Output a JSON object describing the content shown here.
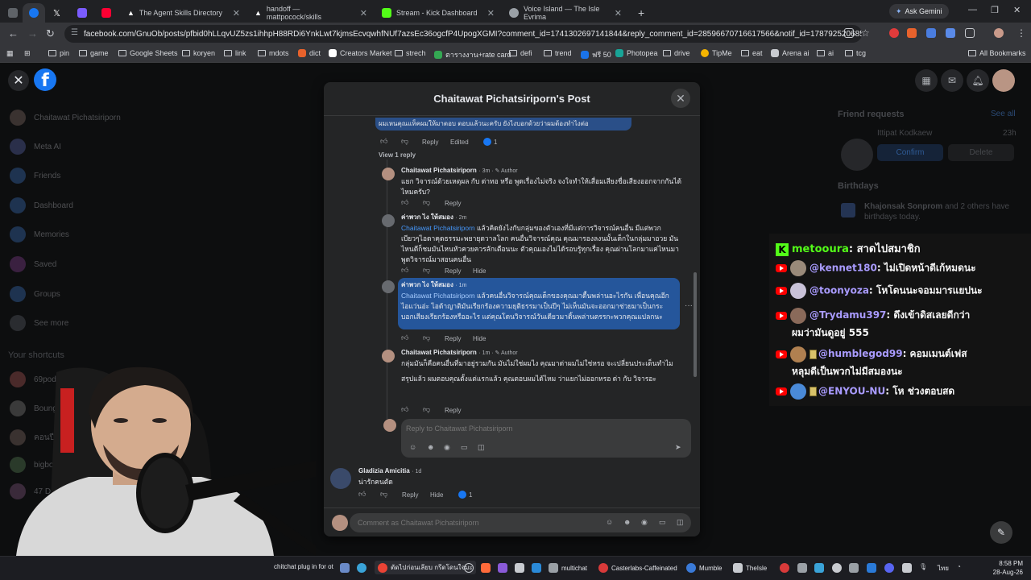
{
  "browser": {
    "tabs": [
      {
        "label": "",
        "favicon_color": "#5f6368"
      },
      {
        "label": "",
        "favicon_color": "#1877f2"
      },
      {
        "label": "",
        "favicon_color": "#ffffff"
      },
      {
        "label": "",
        "favicon_color": "#7b5cff"
      },
      {
        "label": "",
        "favicon_color": "#ff0033"
      },
      {
        "label": "The Agent Skills Directory",
        "favicon_color": "#ffffff"
      },
      {
        "label": "handoff — mattpocock/skills",
        "favicon_color": "#ffffff"
      },
      {
        "label": "Stream - Kick Dashboard",
        "favicon_color": "#53fc18"
      },
      {
        "label": "Voice Island — The Isle Evrima",
        "favicon_color": "#9aa0a6"
      }
    ],
    "new_tab": "+",
    "ask_gemini": "Ask Gemini",
    "url": "facebook.com/GnuOb/posts/pfbid0hLLqvUZ5zs1ihhpH88RDi6YnkLwt7kjmsEcvqwhfNUf7azsEc36ogcfP4UpogXGMI?comment_id=1741302697141844&reply_comment_id=2859667071661756​6&notif_id=1787925206859981&n...",
    "bookmarks": [
      "pin",
      "game",
      "Google Sheets",
      "koryen",
      "link",
      "mdots",
      "dict",
      "Creators Market",
      "strech",
      "ตารางงาน+rate card",
      "defi",
      "trend",
      "ฟรี 50",
      "Photopea",
      "drive",
      "TipMe",
      "eat",
      "Arena ai",
      "ai",
      "tcg"
    ],
    "all_bookmarks": "All Bookmarks"
  },
  "facebook": {
    "sidebar": {
      "items": [
        "Chaitawat Pichatsiriporn",
        "Meta AI",
        "Friends",
        "Dashboard",
        "Memories",
        "Saved",
        "Groups",
        "See more"
      ],
      "shortcuts_heading": "Your shortcuts",
      "shortcuts": [
        "69podcast",
        "Bounglengame",
        "คอนปีน",
        "bigbou",
        "47 De"
      ]
    },
    "right": {
      "friend_requests": "Friend requests",
      "see_all": "See all",
      "request_name": "Ittipat Kodkaew",
      "request_time": "23h",
      "confirm": "Confirm",
      "delete": "Delete",
      "birthdays": "Birthdays",
      "birthday_text_bold": "Khajonsak Sonprom",
      "birthday_text": " and 2 others have birthdays today."
    },
    "modal": {
      "title": "Chaitawat Pichatsiriporn's Post",
      "top_comment_text": "ผมเหนคุณแท็คผมให้มาตอบ ตอบแล้วนะครับ ยังไงบอกด้วยว่าผมต้องทำไงต่อ",
      "top_reply": "Reply",
      "top_edited": "Edited",
      "top_reactions": "1",
      "view_replies": "View 1 reply",
      "comments": [
        {
          "name": "Chaitawat Pichatsiriporn",
          "time": "3m",
          "author": "Author",
          "text": "แยก วิจารณ์ด้วยเหตุผล กับ ด่าทอ หรือ พูดเรื่องไม่จริง จงใจทำให้เสื่อมเสียงชื่อเสียงออกจากกันได้ไหมครับ?",
          "reply": "Reply"
        },
        {
          "name": "ค่าพวก ไง ให้สมอง",
          "time": "2m",
          "mention": "Chaitawat Pichatsiriporn",
          "text": " แล้วคิดยังไงกับกลุ่มของตัวเองที่มีแต่การวิจารณ์คนอื่น มีแต่พวกเบียวๆไอดาคุดธรรมะพยายุดวาลโลก คนอื่นวิจารณ์คุณ คุณมารองลงนมั้นเด็กในกลุ่มมาอวย มันไหนดีก็ชมมันไหนหัวควยควรลักเตือนนะ ตัวคุณเองไม่ได้รอบรู้ทุกเรื่อง คุณผ่านโลกมาแค่ไหนมาพูดวิจารณ์มาสอนคนอื่น",
          "reply": "Reply",
          "hide": "Hide"
        },
        {
          "name": "ค่าพวก ไง ให้สมอง",
          "time": "1m",
          "mention": "Chaitawat Pichatsiriporn",
          "text": " แล้วคนอื่นวิจารณ์คุณเด็กของคุณมาดื้นพล่านอะไรกัน เพื่อนคุณอีกไอแว่นอ่ะ ไอด้าญาติมันเรียกร้องความยุติธรรมาเป็นปีๆ ไม่เห็นมันจะออกมาช่วยมาเป็นกระบอกเสียงเรียกร้องหรืออะไร แต่คุณโดนวิจารณ์วันเดียวมาดิ้นพล่านตรรกะพวกคุณแปลกนะ",
          "reply": "Reply",
          "hide": "Hide"
        },
        {
          "name": "Chaitawat Pichatsiriporn",
          "time": "1m",
          "author": "Author",
          "text": "กลุ่มมันก็คือคนอื่นที่มาอยู่รวมกัน มันไม่ใช่ผมไง คุณมาด่าผมไม่ใช่หรอ จะเปลี่ยนประเด็นทำไม",
          "text2": "สรุปแล้ว ผมตอบคุณตั้งแต่แรกแล้ว คุณตอบผมได้ไหม ว่าแยกไม่ออกหรอ ด่า กับ วิจารอะ",
          "reply": "Reply"
        }
      ],
      "reply_placeholder": "Reply to Chaitawat Pichatsiriporn",
      "next_comment": {
        "name": "Gladizia Amicitia",
        "time": "1d",
        "text": "น่ารักคนตัด",
        "reply": "Reply",
        "hide": "Hide",
        "reactions": "1"
      },
      "comment_placeholder": "Comment as Chaitawat Pichatsiriporn"
    }
  },
  "chat": [
    {
      "platform": "kick",
      "user": "metooura",
      "message": ": สาดไปสมาชิก"
    },
    {
      "platform": "youtube",
      "user": "@kennet180",
      "message": ": ไม่เปิดหน้าดีเก้หมดนะ",
      "avatar_color": "#9a8a7a"
    },
    {
      "platform": "youtube",
      "user": "@toonyoza",
      "message": ": โหโดนนะจอมมารแยปนะ",
      "avatar_color": "#c9c2d8"
    },
    {
      "platform": "youtube",
      "user": "@Trydamu397",
      "message": ": ดึงเข้าดิสเลยดีกว่า",
      "message2": "ผมว่ามันดูอยู่ 555",
      "avatar_color": "#8a6a5a"
    },
    {
      "platform": "youtube",
      "user": "@humblegod99",
      "message": ": คอมเมนต์เฟส",
      "message2": "หลุมดีเป็นพวกไม่มีสมองนะ",
      "avatar_color": "#b08050",
      "badge": true
    },
    {
      "platform": "youtube",
      "user": "@ENYOU-NU",
      "message": ": โห ช่วงตอบสด",
      "avatar_color": "#4a8ad8",
      "badge": true
    }
  ],
  "taskbar": {
    "items": [
      "chitchat plug in for ot",
      "ตัดไปก่อนเลียบ กรีดโดนใจมะ",
      "multichat",
      "Casterlabs-Caffeinated",
      "Mumble",
      "TheIsle"
    ],
    "lang": "ไทย",
    "time": "8:58 PM",
    "date": "28-Aug-26"
  }
}
